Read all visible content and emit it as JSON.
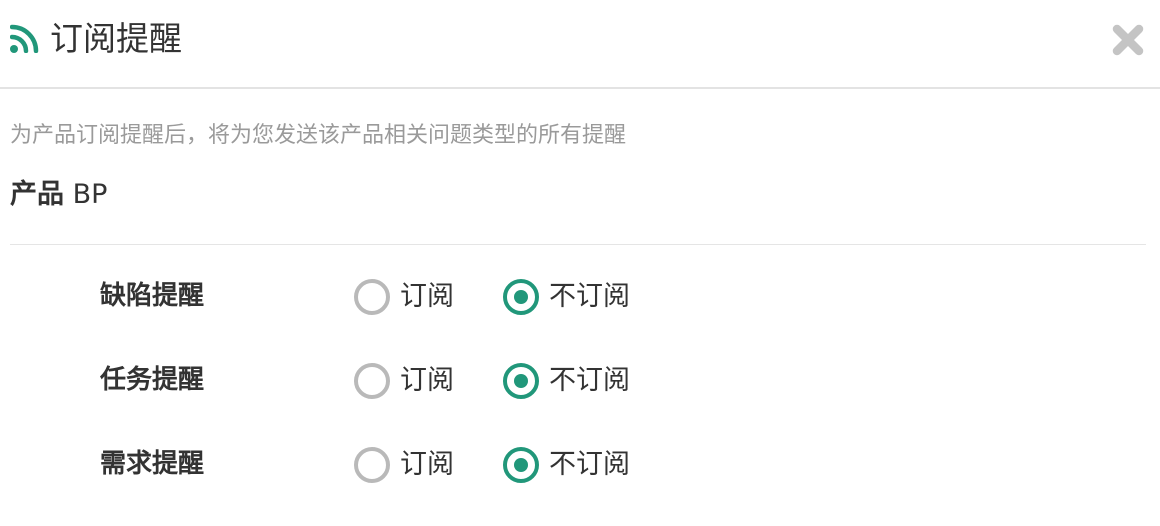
{
  "dialog": {
    "title": "订阅提醒",
    "icon": "rss-icon",
    "close_icon": "close-icon",
    "accent_color": "#21977a"
  },
  "description": "为产品订阅提醒后，将为您发送该产品相关问题类型的所有提醒",
  "product": {
    "label": "产品",
    "name": "BP"
  },
  "settings": [
    {
      "label": "缺陷提醒",
      "options": [
        "订阅",
        "不订阅"
      ],
      "selected": "不订阅"
    },
    {
      "label": "任务提醒",
      "options": [
        "订阅",
        "不订阅"
      ],
      "selected": "不订阅"
    },
    {
      "label": "需求提醒",
      "options": [
        "订阅",
        "不订阅"
      ],
      "selected": "不订阅"
    }
  ]
}
